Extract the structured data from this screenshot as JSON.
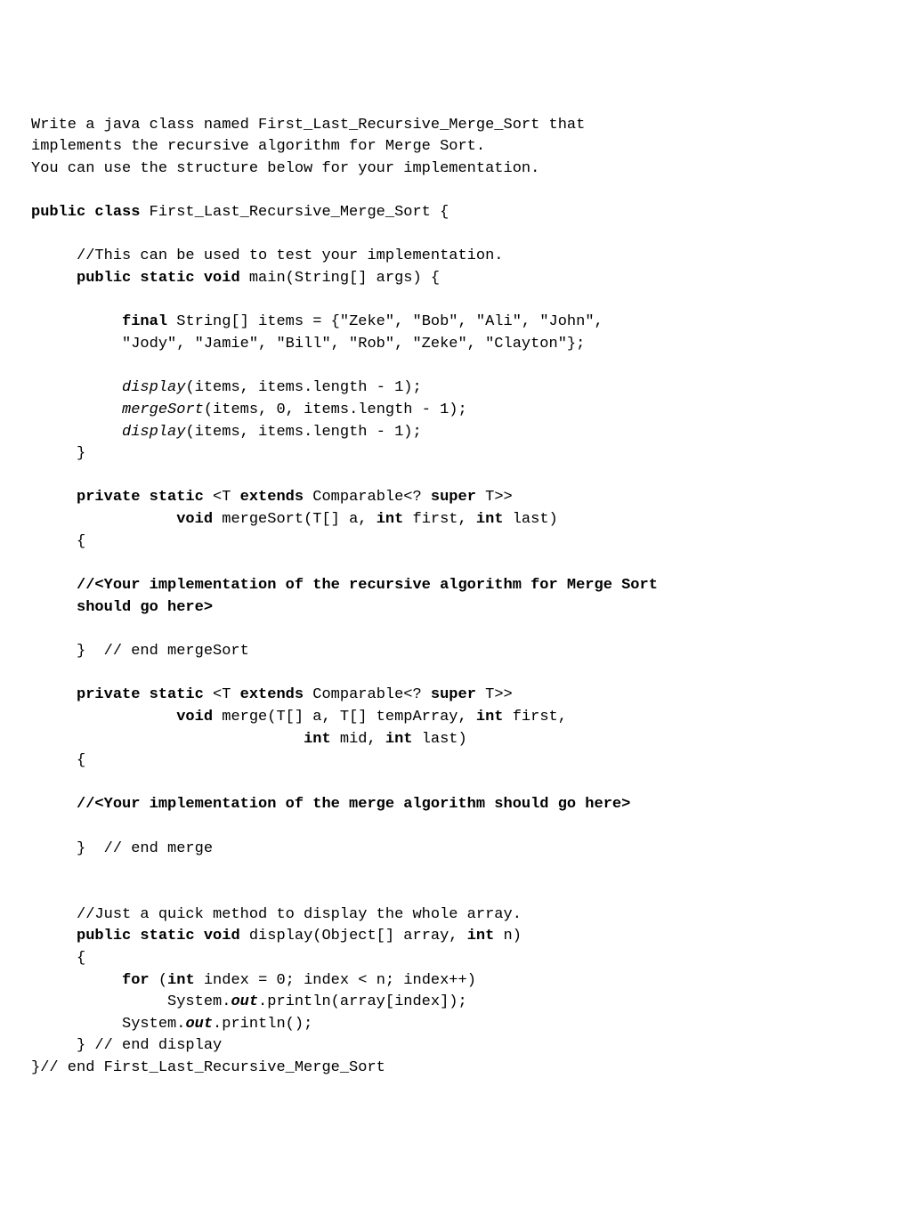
{
  "intro1": "Write a java class named First_Last_Recursive_Merge_Sort that",
  "intro2": "implements the recursive algorithm for Merge Sort.",
  "intro3": "You can use the structure below for your implementation.",
  "classDecl": {
    "kw1": "public class",
    "name": " First_Last_Recursive_Merge_Sort {"
  },
  "cmtTest": "     //This can be used to test your implementation.",
  "mainDecl": {
    "indent": "     ",
    "kw": "public static void",
    "rest": " main(String[] args) {"
  },
  "items1": {
    "indent": "          ",
    "kw": "final",
    "rest": " String[] items = {\"Zeke\", \"Bob\", \"Ali\", \"John\","
  },
  "items2": "          \"Jody\", \"Jamie\", \"Bill\", \"Rob\", \"Zeke\", \"Clayton\"};",
  "disp1": {
    "indent": "          ",
    "call": "display",
    "rest": "(items, items.length - 1);"
  },
  "mergeSortCall": {
    "indent": "          ",
    "call": "mergeSort",
    "rest": "(items, 0, items.length - 1);"
  },
  "disp2": {
    "indent": "          ",
    "call": "display",
    "rest": "(items, items.length - 1);"
  },
  "closeMain": "     }",
  "msDecl1": {
    "indent": "     ",
    "kw1": "private static",
    "g1": " <T ",
    "kw2": "extends",
    "g2": " Comparable<? ",
    "kw3": "super",
    "g3": " T>>"
  },
  "msDecl2": {
    "indent": "                ",
    "kw": "void",
    "rest": " mergeSort(T[] a, ",
    "kw2": "int",
    "p2": " first, ",
    "kw3": "int",
    "p3": " last)"
  },
  "openBrace": "     {",
  "todo1": "     //<Your implementation of the recursive algorithm for Merge Sort",
  "todo1b": "     should go here>",
  "endMergeSort": "     }  // end mergeSort",
  "mDecl1": {
    "indent": "     ",
    "kw1": "private static",
    "g1": " <T ",
    "kw2": "extends",
    "g2": " Comparable<? ",
    "kw3": "super",
    "g3": " T>>"
  },
  "mDecl2": {
    "indent": "                ",
    "kw": "void",
    "rest": " merge(T[] a, T[] tempArray, ",
    "kw2": "int",
    "p2": " first,"
  },
  "mDecl3": {
    "indent": "                              ",
    "kw": "int",
    "p1": " mid, ",
    "kw2": "int",
    "p2": " last)"
  },
  "openBrace2": "     {",
  "todo2": "     //<Your implementation of the merge algorithm should go here>",
  "endMerge": "     }  // end merge",
  "cmtDisplay": "     //Just a quick method to display the whole array.",
  "dispDecl": {
    "indent": "     ",
    "kw": "public static void",
    "rest": " display(Object[] array, ",
    "kw2": "int",
    "p2": " n)"
  },
  "openBrace3": "     {",
  "forLine": {
    "indent": "          ",
    "kw": "for",
    "p1": " (",
    "kw2": "int",
    "rest": " index = 0; index < n; index++)"
  },
  "sout1": {
    "indent": "               System.",
    "out": "out",
    "rest": ".println(array[index]);"
  },
  "sout2": {
    "indent": "          System.",
    "out": "out",
    "rest": ".println();"
  },
  "endDisplay": "     } // end display",
  "endClass": "}// end First_Last_Recursive_Merge_Sort"
}
